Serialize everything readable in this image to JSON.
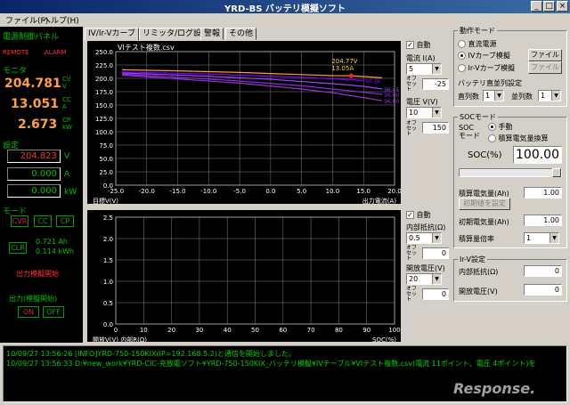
{
  "window": {
    "title": "YRD-BS バッテリ模擬ソフト"
  },
  "menu": {
    "file": "ファイル(F)",
    "help": "ヘルプ(H)"
  },
  "left": {
    "power_panel": "電源制御パネル",
    "remote": "REMOTE",
    "alarm": "ALARM",
    "monitor": "モニタ",
    "voltage": "204.781",
    "voltage_unit": "V",
    "voltage_mode": "CV",
    "current": "13.051",
    "current_unit": "A",
    "current_mode": "CC",
    "power": "2.673",
    "power_unit": "kW",
    "power_mode": "CP",
    "setting": "設定",
    "set_voltage": "204.823",
    "set_voltage_unit": "V",
    "set_current": "0.000",
    "set_current_unit": "A",
    "set_power": "0.000",
    "set_power_unit": "kW",
    "mode_label": "モード",
    "modes": [
      "CVR",
      "CC",
      "CP"
    ],
    "clr": "CLR",
    "ah": "0.721 Ah",
    "kwh": "0.114 kWh",
    "output_sim_start": "出力模擬開始",
    "output_sim_stop": "出力(模擬開始)",
    "on": "ON",
    "off": "OFF"
  },
  "tabs": [
    "IV/Ir-Vカーブ",
    "リミッタ/ログ設定",
    "警報",
    "その他"
  ],
  "chart_top_title": "VIテスト複数.csv",
  "chart_data": [
    {
      "type": "line",
      "title": "VIテスト複数.csv",
      "xlabel": "出力電流(A)",
      "ylabel": "目標V(V)",
      "xlim": [
        -25,
        20
      ],
      "ylim": [
        0,
        250
      ],
      "x_ticks": [
        "-25.0",
        "-20.0",
        "-15.0",
        "-10.0",
        "-5.0",
        "0.0",
        "5.0",
        "10.0",
        "15.0",
        "20.0"
      ],
      "y_ticks": [
        "0.0",
        "25.0",
        "50.0",
        "75.0",
        "100.0",
        "125.0",
        "150.0",
        "175.0",
        "200.0",
        "225.0",
        "250.0"
      ],
      "series": [
        {
          "color": "#ff9a40",
          "x": [
            -24,
            -15,
            -5,
            0,
            5,
            10,
            13,
            18
          ],
          "y": [
            216,
            214,
            211,
            209,
            207,
            205,
            204.77,
            201
          ]
        },
        {
          "color": "#8000ff",
          "x": [
            -24,
            -10,
            0,
            5,
            10,
            15
          ],
          "y": [
            212,
            208,
            204,
            202,
            199,
            196
          ]
        },
        {
          "color": "#a040ff",
          "x": [
            -24,
            -10,
            0,
            10,
            15,
            18
          ],
          "y": [
            210,
            204,
            198,
            190,
            185,
            180
          ]
        },
        {
          "color": "#8a2be2",
          "x": [
            -24,
            -5,
            5,
            10,
            15,
            18
          ],
          "y": [
            208,
            195,
            186,
            180,
            174,
            170
          ]
        },
        {
          "color": "#9932cc",
          "x": [
            -24,
            -5,
            5,
            10,
            15,
            18
          ],
          "y": [
            206,
            191,
            180,
            173,
            164,
            158
          ]
        }
      ],
      "point_labels": [
        "96.46",
        "96.45",
        "96.00",
        "96.00"
      ],
      "cursor": {
        "x": 13,
        "y": 204.77,
        "label_v": "204.77V",
        "label_a": "13.05A"
      }
    },
    {
      "type": "line",
      "xlabel": "SOC(%)",
      "ylabel": "開放V(V) 内部R(Ω)",
      "xlim": [
        0,
        100
      ],
      "ylim": [
        0,
        2.5
      ],
      "x_ticks": [
        "0",
        "10",
        "20",
        "30",
        "40",
        "50",
        "60",
        "70",
        "80",
        "90",
        "100"
      ],
      "y_ticks": [
        "0.0",
        "0.5",
        "1.0",
        "1.5",
        "2.0",
        "2.5"
      ],
      "series": []
    }
  ],
  "chart_controls": {
    "auto1": "自動",
    "current_label": "電流 I(A)",
    "current_select": "5",
    "offset": "オフセット",
    "current_offset": "-25",
    "voltage_label": "電圧 V(V)",
    "voltage_select": "10",
    "voltage_offset": "150",
    "auto2": "自動",
    "resistance_label": "内部抵抗(Ω)",
    "resistance_select": "0.5",
    "resistance_offset": "0",
    "openv_label": "開放電圧(V)",
    "openv_select": "20",
    "openv_offset": "0"
  },
  "right": {
    "op_mode": "動作モード",
    "dc_source": "直流電源",
    "iv_curve": "IVカーブ模擬",
    "irv_curve": "Ir-Vカーブ模擬",
    "file": "ファイル",
    "battery_setting": "バッテリ直並列設定",
    "series_count": "直列数",
    "series_val": "1",
    "parallel_count": "並列数",
    "parallel_val": "1",
    "soc_mode_title": "SOCモード",
    "soc_mode": "SOC\nモード",
    "manual": "手動",
    "accumulate": "積算電気量換算",
    "soc_label": "SOC(%)",
    "soc_value": "100.00",
    "acc_charge": "積算電気量(Ah)",
    "acc_charge_val": "1.00",
    "init_set": "初期値を設定",
    "init_charge": "初期電気量(Ah)",
    "init_charge_val": "1.00",
    "acc_mult": "積算量倍率",
    "acc_mult_val": "1",
    "irv_setting": "Ir-V設定",
    "int_res": "内部抵抗(Ω)",
    "int_res_val": "0",
    "open_v": "開放電圧(V)",
    "open_v_val": "0"
  },
  "log": [
    "10/09/27 13:56:26 [INFO]YRD-750-150KIX(IP=192.168.5.2)と通信を開始しました。",
    "10/09/27 13:56:33 D:¥new_work¥YRD-CIC-充放電ソフト¥YRD-750-150KIX_バッテリ模擬¥IVテーブル¥VIテスト複数.csv(電流 11ポイント、電圧 4ポイント)を"
  ],
  "watermark": "Response."
}
